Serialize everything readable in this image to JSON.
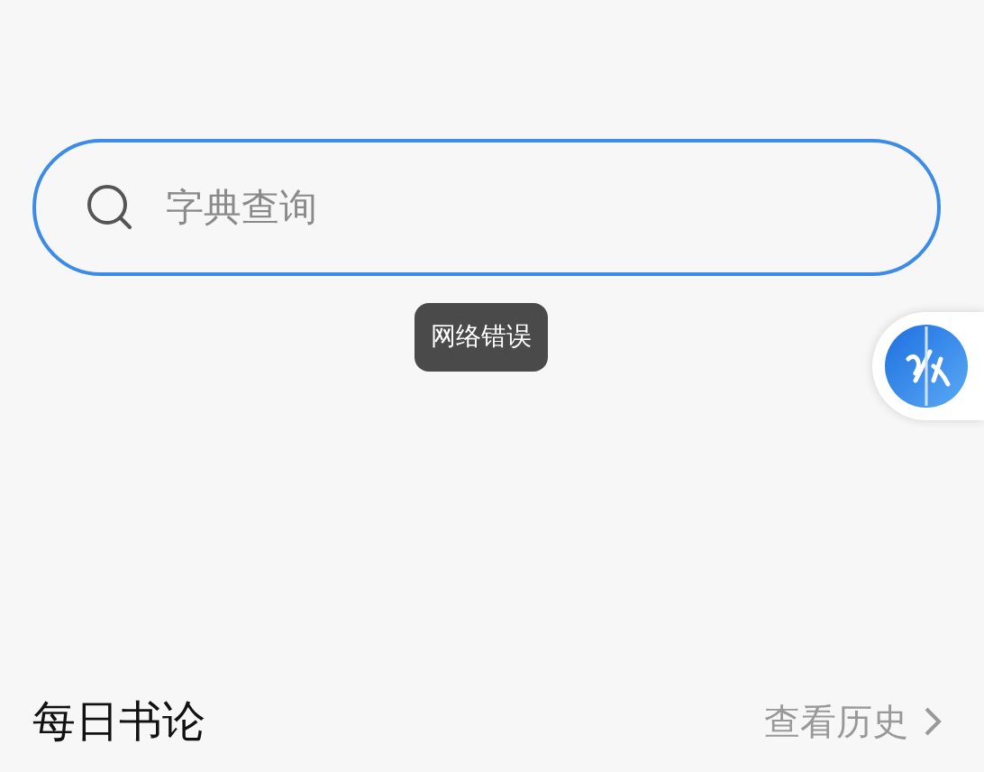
{
  "search": {
    "placeholder": "字典查询"
  },
  "toast": {
    "text": "网络错误"
  },
  "section": {
    "title": "每日书论",
    "link": "查看历史"
  }
}
